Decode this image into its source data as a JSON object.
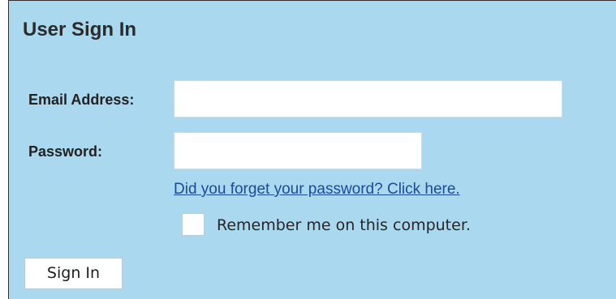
{
  "panel": {
    "title": "User Sign In"
  },
  "form": {
    "email_label": "Email Address:",
    "email_value": "",
    "password_label": "Password:",
    "password_value": "",
    "forgot_link": "Did you forget your password? Click here.",
    "remember_label": "Remember me on this computer.",
    "remember_checked": false,
    "signin_label": "Sign In"
  },
  "colors": {
    "panel_background": "#aad8ee",
    "link": "#1a4a9a"
  }
}
